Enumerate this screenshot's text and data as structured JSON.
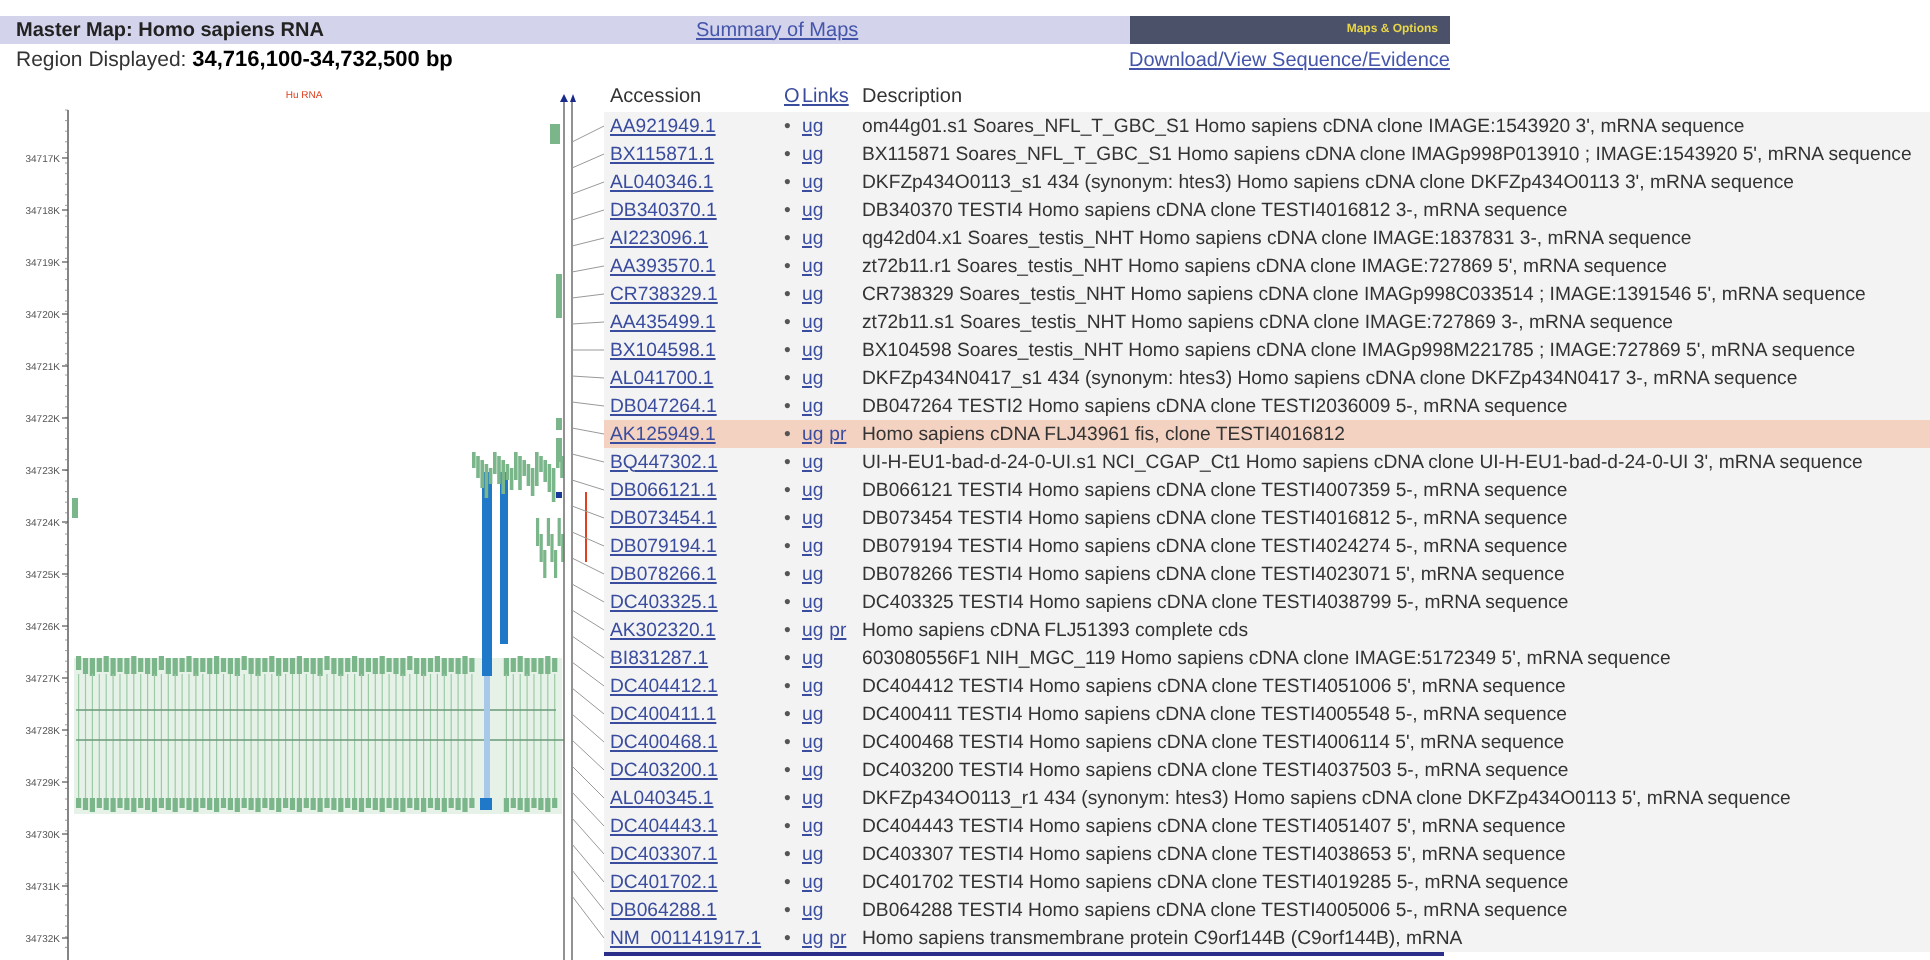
{
  "header": {
    "title": "Master Map: Homo sapiens RNA",
    "summary_link": "Summary of Maps",
    "options_button": "Maps & Options"
  },
  "region": {
    "label": "Region Displayed:",
    "value": "34,716,100-34,732,500 bp"
  },
  "download_link": "Download/View Sequence/Evidence",
  "map": {
    "track_label": "Hu RNA",
    "axis_ticks": [
      "34717K",
      "34718K",
      "34719K",
      "34720K",
      "34721K",
      "34722K",
      "34723K",
      "34724K",
      "34725K",
      "34726K",
      "34727K",
      "34728K",
      "34729K",
      "34730K",
      "34731K",
      "34732K"
    ]
  },
  "table": {
    "columns": [
      "Accession",
      "O",
      "Links",
      "Description"
    ],
    "rows": [
      {
        "accession": "AA921949.1",
        "marker": "•",
        "links": [
          "ug"
        ],
        "description": "om44g01.s1 Soares_NFL_T_GBC_S1 Homo sapiens cDNA clone IMAGE:1543920 3', mRNA sequence",
        "selected": false
      },
      {
        "accession": "BX115871.1",
        "marker": "•",
        "links": [
          "ug"
        ],
        "description": "BX115871 Soares_NFL_T_GBC_S1 Homo sapiens cDNA clone IMAGp998P013910 ; IMAGE:1543920 5', mRNA sequence",
        "selected": false
      },
      {
        "accession": "AL040346.1",
        "marker": "•",
        "links": [
          "ug"
        ],
        "description": "DKFZp434O0113_s1 434 (synonym: htes3) Homo sapiens cDNA clone DKFZp434O0113 3', mRNA sequence",
        "selected": false
      },
      {
        "accession": "DB340370.1",
        "marker": "•",
        "links": [
          "ug"
        ],
        "description": "DB340370 TESTI4 Homo sapiens cDNA clone TESTI4016812 3-, mRNA sequence",
        "selected": false
      },
      {
        "accession": "AI223096.1",
        "marker": "•",
        "links": [
          "ug"
        ],
        "description": "qg42d04.x1 Soares_testis_NHT Homo sapiens cDNA clone IMAGE:1837831 3-, mRNA sequence",
        "selected": false
      },
      {
        "accession": "AA393570.1",
        "marker": "•",
        "links": [
          "ug"
        ],
        "description": "zt72b11.r1 Soares_testis_NHT Homo sapiens cDNA clone IMAGE:727869 5', mRNA sequence",
        "selected": false
      },
      {
        "accession": "CR738329.1",
        "marker": "•",
        "links": [
          "ug"
        ],
        "description": "CR738329 Soares_testis_NHT Homo sapiens cDNA clone IMAGp998C033514 ; IMAGE:1391546 5', mRNA sequence",
        "selected": false
      },
      {
        "accession": "AA435499.1",
        "marker": "•",
        "links": [
          "ug"
        ],
        "description": "zt72b11.s1 Soares_testis_NHT Homo sapiens cDNA clone IMAGE:727869 3-, mRNA sequence",
        "selected": false
      },
      {
        "accession": "BX104598.1",
        "marker": "•",
        "links": [
          "ug"
        ],
        "description": "BX104598 Soares_testis_NHT Homo sapiens cDNA clone IMAGp998M221785 ; IMAGE:727869 5', mRNA sequence",
        "selected": false
      },
      {
        "accession": "AL041700.1",
        "marker": "•",
        "links": [
          "ug"
        ],
        "description": "DKFZp434N0417_s1 434 (synonym: htes3) Homo sapiens cDNA clone DKFZp434N0417 3-, mRNA sequence",
        "selected": false
      },
      {
        "accession": "DB047264.1",
        "marker": "•",
        "links": [
          "ug"
        ],
        "description": "DB047264 TESTI2 Homo sapiens cDNA clone TESTI2036009 5-, mRNA sequence",
        "selected": false
      },
      {
        "accession": "AK125949.1",
        "marker": "•",
        "links": [
          "ug",
          "pr"
        ],
        "description": "Homo sapiens cDNA FLJ43961 fis, clone TESTI4016812",
        "selected": true
      },
      {
        "accession": "BQ447302.1",
        "marker": "•",
        "links": [
          "ug"
        ],
        "description": "UI-H-EU1-bad-d-24-0-UI.s1 NCI_CGAP_Ct1 Homo sapiens cDNA clone UI-H-EU1-bad-d-24-0-UI 3', mRNA sequence",
        "selected": false
      },
      {
        "accession": "DB066121.1",
        "marker": "•",
        "links": [
          "ug"
        ],
        "description": "DB066121 TESTI4 Homo sapiens cDNA clone TESTI4007359 5-, mRNA sequence",
        "selected": false
      },
      {
        "accession": "DB073454.1",
        "marker": "•",
        "links": [
          "ug"
        ],
        "description": "DB073454 TESTI4 Homo sapiens cDNA clone TESTI4016812 5-, mRNA sequence",
        "selected": false
      },
      {
        "accession": "DB079194.1",
        "marker": "•",
        "links": [
          "ug"
        ],
        "description": "DB079194 TESTI4 Homo sapiens cDNA clone TESTI4024274 5-, mRNA sequence",
        "selected": false
      },
      {
        "accession": "DB078266.1",
        "marker": "•",
        "links": [
          "ug"
        ],
        "description": "DB078266 TESTI4 Homo sapiens cDNA clone TESTI4023071 5', mRNA sequence",
        "selected": false
      },
      {
        "accession": "DC403325.1",
        "marker": "•",
        "links": [
          "ug"
        ],
        "description": "DC403325 TESTI4 Homo sapiens cDNA clone TESTI4038799 5-, mRNA sequence",
        "selected": false
      },
      {
        "accession": "AK302320.1",
        "marker": "•",
        "links": [
          "ug",
          "pr"
        ],
        "description": "Homo sapiens cDNA FLJ51393 complete cds",
        "selected": false
      },
      {
        "accession": "BI831287.1",
        "marker": "•",
        "links": [
          "ug"
        ],
        "description": "603080556F1 NIH_MGC_119 Homo sapiens cDNA clone IMAGE:5172349 5', mRNA sequence",
        "selected": false
      },
      {
        "accession": "DC404412.1",
        "marker": "•",
        "links": [
          "ug"
        ],
        "description": "DC404412 TESTI4 Homo sapiens cDNA clone TESTI4051006 5', mRNA sequence",
        "selected": false
      },
      {
        "accession": "DC400411.1",
        "marker": "•",
        "links": [
          "ug"
        ],
        "description": "DC400411 TESTI4 Homo sapiens cDNA clone TESTI4005548 5-, mRNA sequence",
        "selected": false
      },
      {
        "accession": "DC400468.1",
        "marker": "•",
        "links": [
          "ug"
        ],
        "description": "DC400468 TESTI4 Homo sapiens cDNA clone TESTI4006114 5', mRNA sequence",
        "selected": false
      },
      {
        "accession": "DC403200.1",
        "marker": "•",
        "links": [
          "ug"
        ],
        "description": "DC403200 TESTI4 Homo sapiens cDNA clone TESTI4037503 5-, mRNA sequence",
        "selected": false
      },
      {
        "accession": "AL040345.1",
        "marker": "•",
        "links": [
          "ug"
        ],
        "description": "DKFZp434O0113_r1 434 (synonym: htes3) Homo sapiens cDNA clone DKFZp434O0113 5', mRNA sequence",
        "selected": false
      },
      {
        "accession": "DC404443.1",
        "marker": "•",
        "links": [
          "ug"
        ],
        "description": "DC404443 TESTI4 Homo sapiens cDNA clone TESTI4051407 5', mRNA sequence",
        "selected": false
      },
      {
        "accession": "DC403307.1",
        "marker": "•",
        "links": [
          "ug"
        ],
        "description": "DC403307 TESTI4 Homo sapiens cDNA clone TESTI4038653 5', mRNA sequence",
        "selected": false
      },
      {
        "accession": "DC401702.1",
        "marker": "•",
        "links": [
          "ug"
        ],
        "description": "DC401702 TESTI4 Homo sapiens cDNA clone TESTI4019285 5-, mRNA sequence",
        "selected": false
      },
      {
        "accession": "DB064288.1",
        "marker": "•",
        "links": [
          "ug"
        ],
        "description": "DB064288 TESTI4 Homo sapiens cDNA clone TESTI4005006 5-, mRNA sequence",
        "selected": false
      },
      {
        "accession": "NM_001141917.1",
        "marker": "•",
        "links": [
          "ug",
          "pr"
        ],
        "description": "Homo sapiens transmembrane protein C9orf144B (C9orf144B), mRNA",
        "selected": false
      }
    ]
  }
}
